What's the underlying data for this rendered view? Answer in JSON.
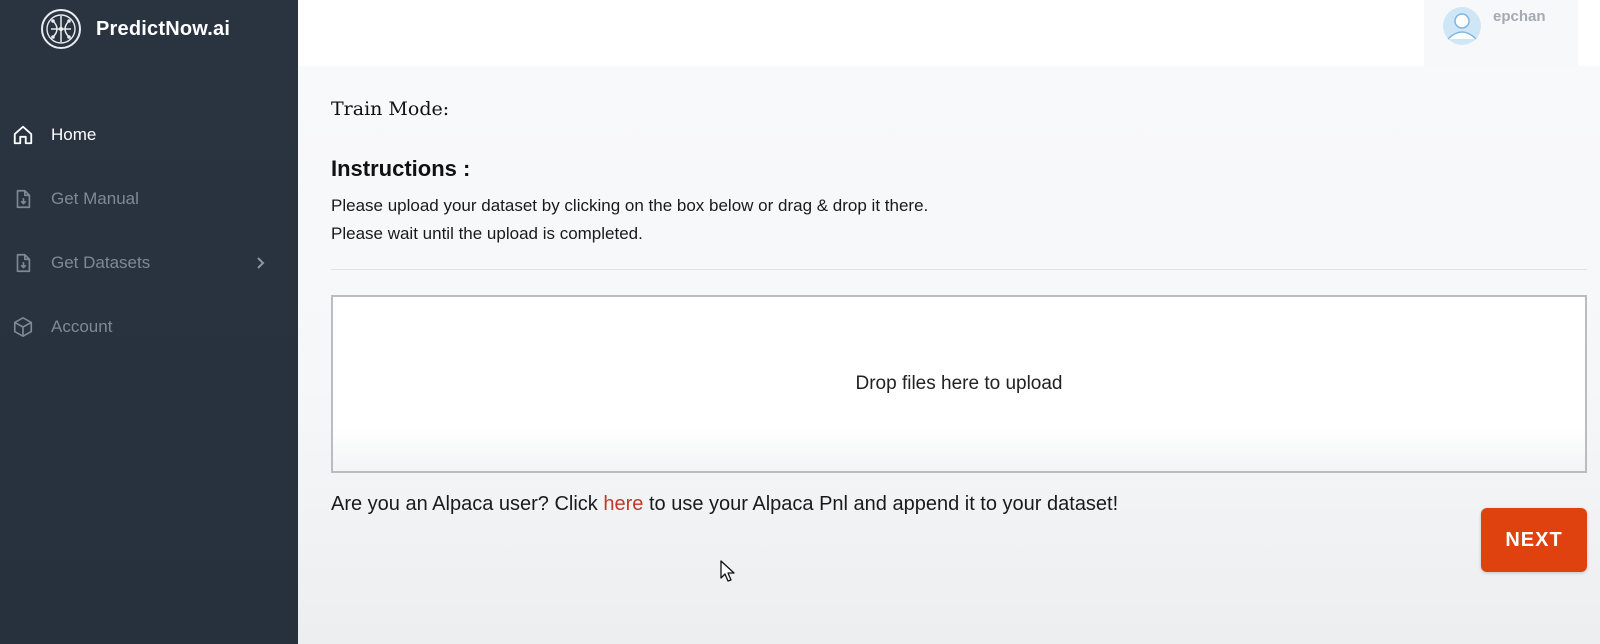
{
  "brand": {
    "name": "PredictNow.ai",
    "logo_icon": "brain-circuit-icon"
  },
  "sidebar": {
    "items": [
      {
        "label": "Home",
        "icon": "home-icon",
        "active": true
      },
      {
        "label": "Get Manual",
        "icon": "file-download-icon",
        "active": false
      },
      {
        "label": "Get Datasets",
        "icon": "file-download-icon",
        "active": false,
        "has_submenu": true
      },
      {
        "label": "Account",
        "icon": "cube-icon",
        "active": false
      }
    ]
  },
  "header": {
    "username": "epchan",
    "avatar_icon": "user-avatar-icon"
  },
  "main": {
    "train_mode_label": "Train Mode:",
    "instructions_title": "Instructions :",
    "instruction_line_1": "Please upload your dataset by clicking on the box below or drag & drop it there.",
    "instruction_line_2": "Please wait until the upload is completed.",
    "dropzone_text": "Drop files here to upload",
    "alpaca_prefix": "Are you an Alpaca user? Click ",
    "alpaca_link": "here",
    "alpaca_suffix": " to use your Alpaca Pnl and append it to your dataset!",
    "next_button": "NEXT"
  },
  "colors": {
    "sidebar_bg": "#29333f",
    "accent_button": "#e0420f",
    "link": "#c0392b"
  }
}
